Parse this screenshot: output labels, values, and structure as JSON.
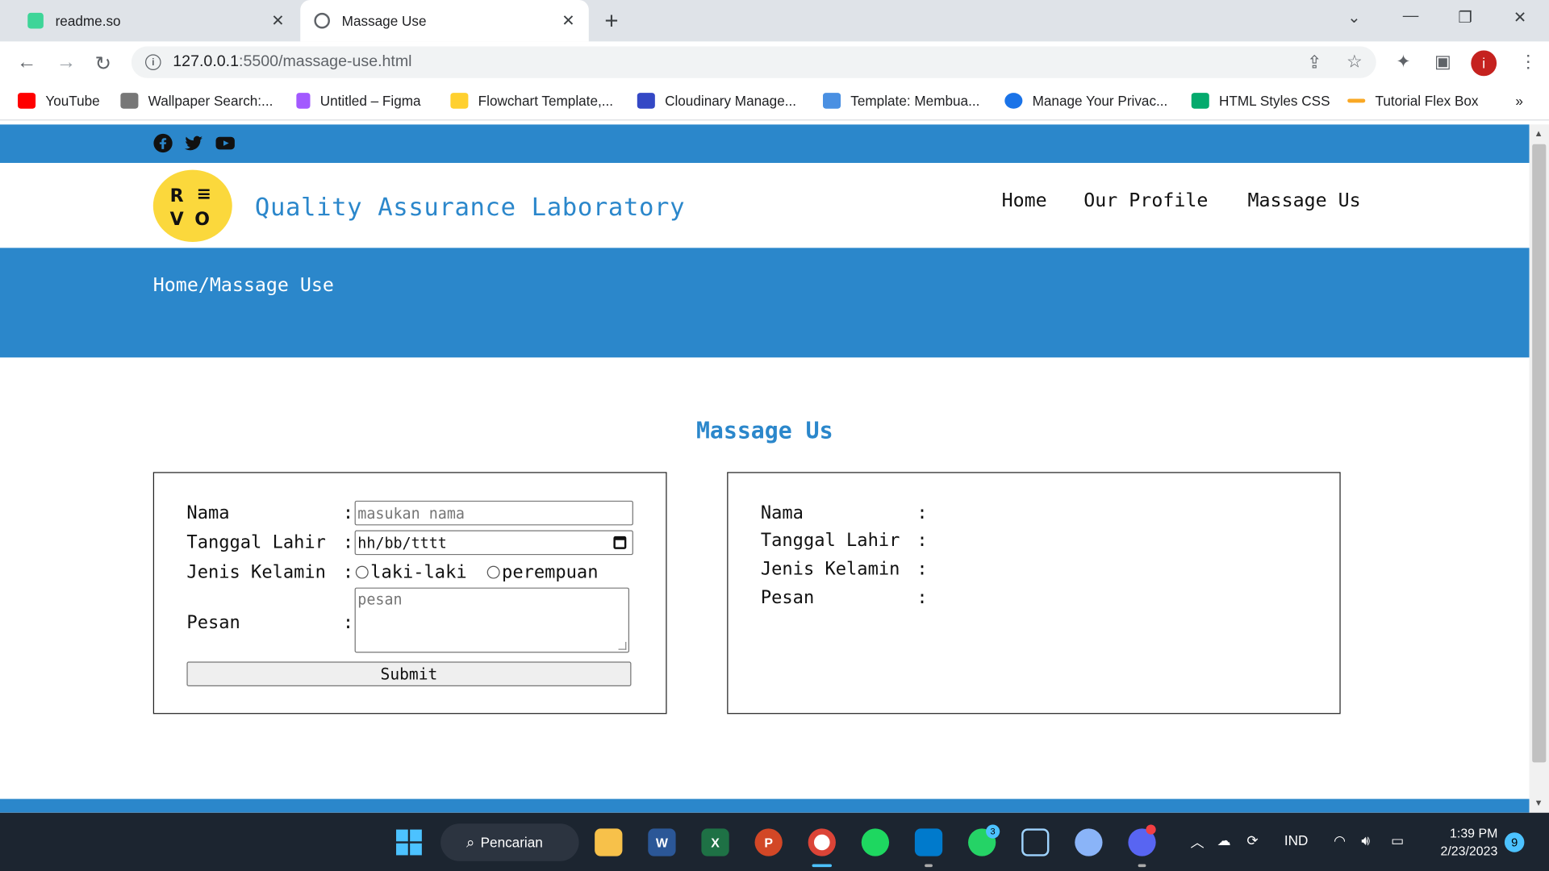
{
  "browser": {
    "tabs": [
      {
        "title": "readme.so",
        "active": false
      },
      {
        "title": "Massage Use",
        "active": true
      }
    ],
    "url_host": "127.0.0.1",
    "url_path": ":5500/massage-use.html",
    "profile_initial": "i",
    "bookmarks": [
      {
        "label": "YouTube",
        "color": "#ff0000"
      },
      {
        "label": "Wallpaper Search:...",
        "color": "#777777"
      },
      {
        "label": "Untitled – Figma",
        "color": "#a259ff"
      },
      {
        "label": "Flowchart Template,...",
        "color": "#ffd02f"
      },
      {
        "label": "Cloudinary Manage...",
        "color": "#3448c5"
      },
      {
        "label": "Template: Membua...",
        "color": "#4a90e2"
      },
      {
        "label": "Manage Your Privac...",
        "color": "#1a73e8"
      },
      {
        "label": "HTML Styles CSS",
        "color": "#04aa6d"
      },
      {
        "label": "Tutorial Flex Box",
        "color": "#f9a825"
      }
    ],
    "more_bookmarks": "»"
  },
  "site": {
    "title": "Quality Assurance Laboratory",
    "logo_letters": [
      "R",
      "≡",
      "V",
      "O"
    ],
    "nav": [
      "Home",
      "Our Profile",
      "Massage Us"
    ],
    "breadcrumb": "Home/Massage Use",
    "social_icons": [
      "facebook-icon",
      "twitter-icon",
      "youtube-icon"
    ],
    "accent": "#2b87cb"
  },
  "form": {
    "heading": "Massage Us",
    "labels": {
      "nama": "Nama",
      "tanggal": "Tanggal Lahir",
      "jenis": "Jenis Kelamin",
      "pesan": "Pesan"
    },
    "colon": ":",
    "nama_placeholder": "masukan nama",
    "tanggal_placeholder": "hh/bb/tttt",
    "gender_options": [
      "laki-laki",
      "perempuan"
    ],
    "pesan_placeholder": "pesan",
    "submit_label": "Submit"
  },
  "output": {
    "labels": [
      "Nama",
      "Tanggal Lahir",
      "Jenis Kelamin",
      "Pesan"
    ],
    "colon": ":"
  },
  "taskbar": {
    "search_label": "Pencarian",
    "language": "IND",
    "time": "1:39 PM",
    "date": "2/23/2023",
    "notification_count": "9",
    "whatsapp_badge": "3"
  }
}
